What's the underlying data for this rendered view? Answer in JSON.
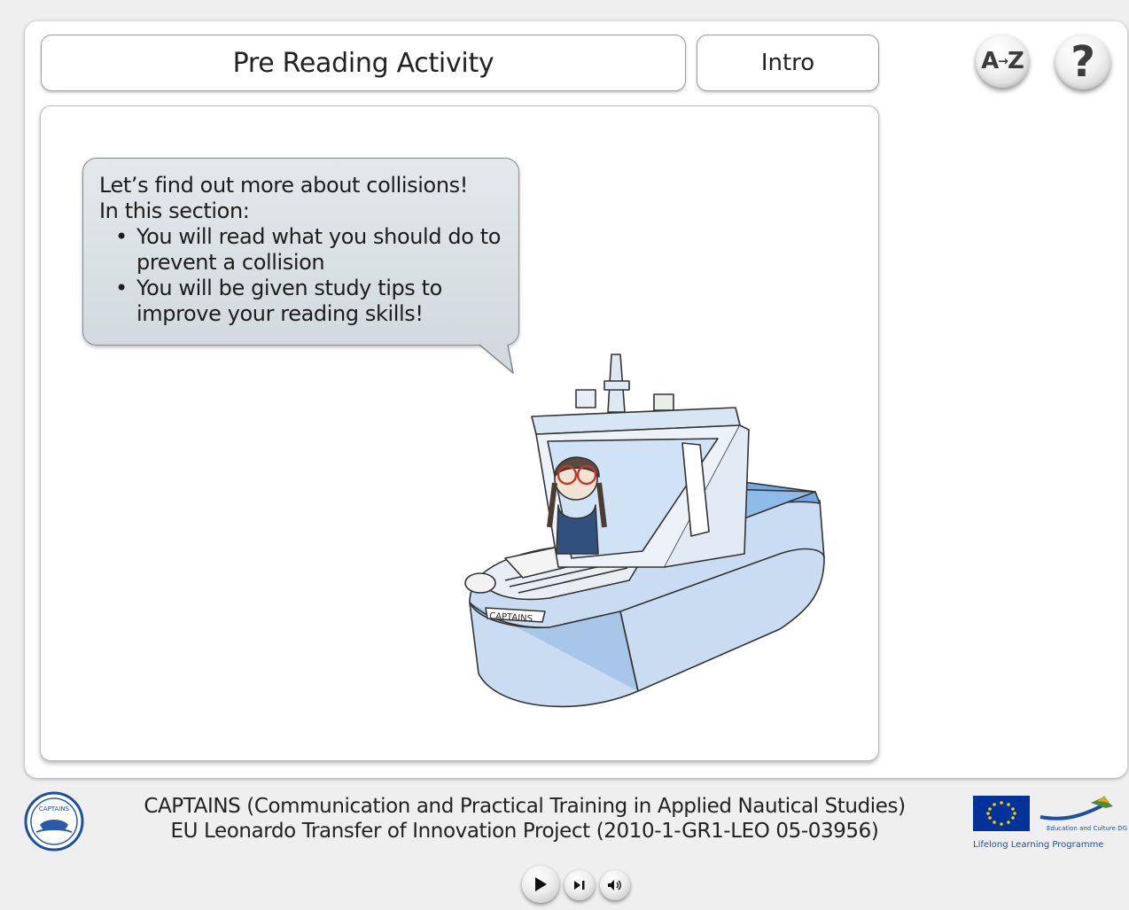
{
  "header": {
    "title": "Pre Reading Activity",
    "section": "Intro",
    "glossary_button": {
      "label": "A-Z",
      "icon": "az-dictionary-icon"
    },
    "help_button": {
      "label": "?",
      "icon": "help-icon"
    }
  },
  "speech_bubble": {
    "line1": "Let’s find out more about collisions!",
    "line2": "In this section:",
    "bullets": [
      "You will read what you should do to prevent a collision",
      "You will be given study tips to improve your reading skills!"
    ]
  },
  "illustration": {
    "boat_name": "CAPTAINS"
  },
  "footer": {
    "line1": "CAPTAINS (Communication and Practical Training in Applied Nautical Studies)",
    "line2": "EU Leonardo Transfer of Innovation Project (2010-1-GR1-LEO 05-03956)",
    "eu_tagline": "Education and Culture DG",
    "eu_programme": "Lifelong Learning Programme",
    "logo_text": "CAPTAINS"
  },
  "media_controls": {
    "play_icon": "play-icon",
    "skip_icon": "skip-icon",
    "volume_icon": "volume-icon"
  },
  "colors": {
    "bubble_bg": "#dbe2e6",
    "boat_blue": "#9cc3ea",
    "eu_blue": "#003399",
    "eu_star": "#ffcc00"
  }
}
